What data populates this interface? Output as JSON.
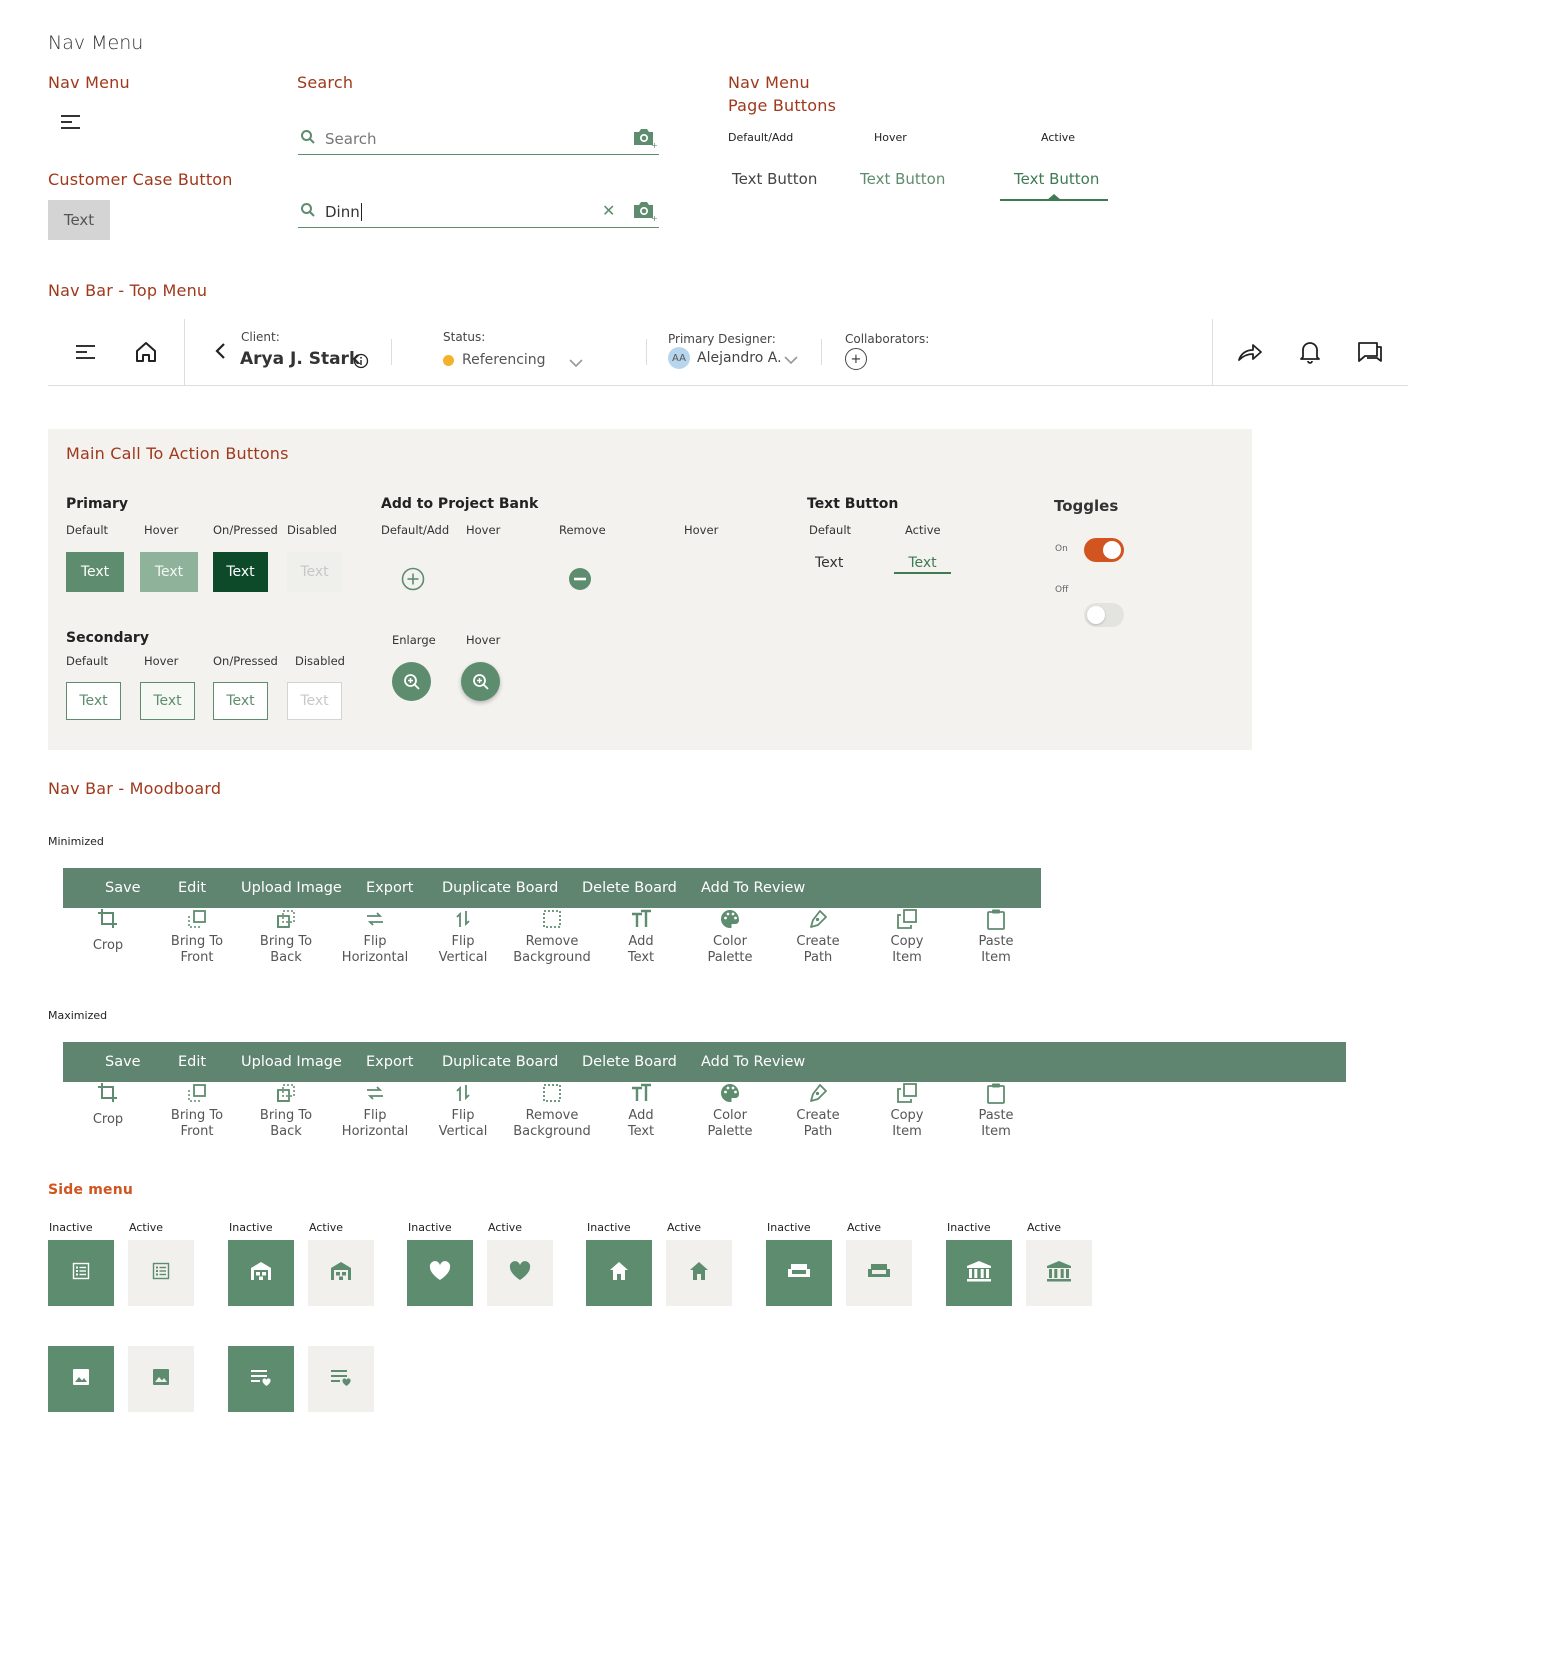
{
  "page_title": "Nav Menu",
  "nav_menu": {
    "title": "Nav Menu"
  },
  "customer_case": {
    "title": "Customer Case Button",
    "button_label": "Text"
  },
  "search": {
    "title": "Search",
    "placeholder": "Search",
    "typed_value": "Dinn"
  },
  "page_buttons": {
    "title_line1": "Nav Menu",
    "title_line2": "Page Buttons",
    "states": [
      "Default/Add",
      "Hover",
      "Active"
    ],
    "label": "Text Button"
  },
  "top_menu": {
    "title": "Nav Bar - Top Menu",
    "client_label": "Client:",
    "client_name": "Arya J. Stark",
    "status_label": "Status:",
    "status_value": "Referencing",
    "status_color": "#f4b12a",
    "designer_label": "Primary Designer:",
    "designer_initials": "AA",
    "designer_name": "Alejandro A.",
    "collaborators_label": "Collaborators:"
  },
  "cta": {
    "title": "Main Call To Action Buttons",
    "primary": {
      "title": "Primary",
      "states": [
        "Default",
        "Hover",
        "On/Pressed",
        "Disabled"
      ],
      "label": "Text"
    },
    "secondary": {
      "title": "Secondary",
      "states": [
        "Default",
        "Hover",
        "On/Pressed",
        "Disabled"
      ],
      "label": "Text"
    },
    "project_bank": {
      "title": "Add to Project Bank",
      "states": [
        "Default/Add",
        "Hover",
        "Remove",
        "Hover"
      ],
      "enlarge": "Enlarge",
      "enlarge_hover": "Hover"
    },
    "text_button": {
      "title": "Text Button",
      "states": [
        "Default",
        "Active"
      ],
      "label": "Text"
    },
    "toggles": {
      "title": "Toggles",
      "on": "On",
      "off": "Off",
      "on_color": "#d2541f"
    }
  },
  "moodboard": {
    "title": "Nav Bar - Moodboard",
    "minimized_label": "Minimized",
    "maximized_label": "Maximized",
    "menu": [
      "Save",
      "Edit",
      "Upload Image",
      "Export",
      "Duplicate Board",
      "Delete Board",
      "Add To Review"
    ],
    "tools": [
      {
        "line1": "Crop",
        "line2": "",
        "icon": "crop-icon"
      },
      {
        "line1": "Bring To",
        "line2": "Front",
        "icon": "bring-front-icon"
      },
      {
        "line1": "Bring To",
        "line2": "Back",
        "icon": "bring-back-icon"
      },
      {
        "line1": "Flip",
        "line2": "Horizontal",
        "icon": "flip-horizontal-icon"
      },
      {
        "line1": "Flip",
        "line2": "Vertical",
        "icon": "flip-vertical-icon"
      },
      {
        "line1": "Remove",
        "line2": "Background",
        "icon": "remove-background-icon"
      },
      {
        "line1": "Add",
        "line2": "Text",
        "icon": "add-text-icon"
      },
      {
        "line1": "Color",
        "line2": "Palette",
        "icon": "palette-icon"
      },
      {
        "line1": "Create",
        "line2": "Path",
        "icon": "pen-icon"
      },
      {
        "line1": "Copy",
        "line2": "Item",
        "icon": "copy-icon"
      },
      {
        "line1": "Paste",
        "line2": "Item",
        "icon": "paste-icon"
      }
    ]
  },
  "side_menu": {
    "title": "Side menu",
    "inactive": "Inactive",
    "active": "Active",
    "icons": [
      "list-icon",
      "warehouse-icon",
      "heart-icon",
      "home-icon",
      "sofa-icon",
      "bank-icon",
      "image-icon",
      "playlist-heart-icon"
    ]
  },
  "colors": {
    "brand_green": "#5e8c6e",
    "dark_green": "#0d4a2a",
    "section_title": "#a0381c",
    "accent_orange": "#d2541f"
  }
}
